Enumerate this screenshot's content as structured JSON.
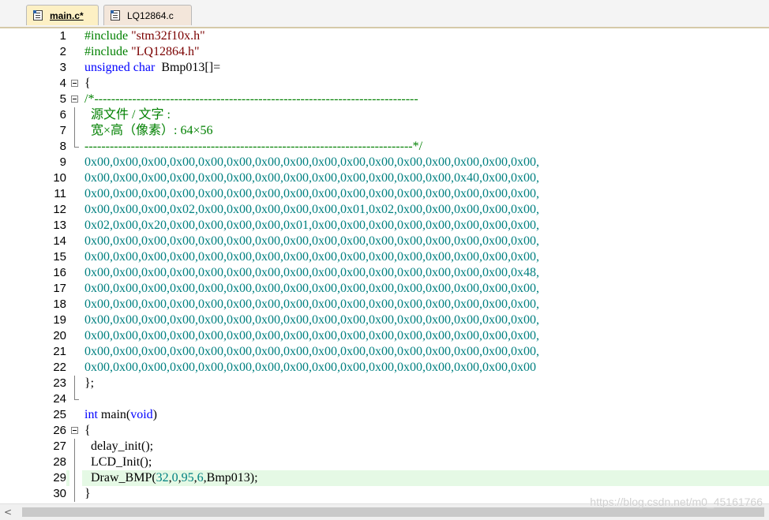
{
  "tabs": [
    {
      "label": "main.c*",
      "active": true
    },
    {
      "label": "LQ12864.c",
      "active": false
    }
  ],
  "colors": {
    "preprocessor": "#008000",
    "string": "#7a0000",
    "keyword": "#0000ff",
    "comment": "#008000",
    "hex_literal": "#008080",
    "current_line_bg": "#e5f9e5",
    "active_tab_bg": "#fdf0c4"
  },
  "lines": [
    {
      "n": "1",
      "tokens": [
        [
          "pp",
          "#include "
        ],
        [
          "str",
          "\"stm32f10x.h\""
        ]
      ]
    },
    {
      "n": "2",
      "tokens": [
        [
          "pp",
          "#include "
        ],
        [
          "str",
          "\"LQ12864.h\""
        ]
      ]
    },
    {
      "n": "3",
      "tokens": [
        [
          "kw",
          "unsigned"
        ],
        [
          "punc",
          " "
        ],
        [
          "kw",
          "char"
        ],
        [
          "punc",
          "  Bmp013[]="
        ]
      ]
    },
    {
      "n": "4",
      "fold": "box",
      "tokens": [
        [
          "punc",
          "{"
        ]
      ]
    },
    {
      "n": "5",
      "fold": "box",
      "tokens": [
        [
          "cmt",
          "/*-----------------------------------------------------------------------------"
        ]
      ]
    },
    {
      "n": "6",
      "fold": "line",
      "tokens": [
        [
          "cmt",
          "  源文件 / 文字 :"
        ]
      ]
    },
    {
      "n": "7",
      "fold": "line",
      "tokens": [
        [
          "cmt",
          "  宽×高（像素）: 64×56"
        ]
      ]
    },
    {
      "n": "8",
      "fold": "end",
      "tokens": [
        [
          "cmt",
          "------------------------------------------------------------------------------*/"
        ]
      ]
    },
    {
      "n": "9",
      "tokens": [
        [
          "hex",
          "0x00,0x00,0x00,0x00,0x00,0x00,0x00,0x00,0x00,0x00,0x00,0x00,0x00,0x00,0x00,0x00,"
        ]
      ]
    },
    {
      "n": "10",
      "tokens": [
        [
          "hex",
          "0x00,0x00,0x00,0x00,0x00,0x00,0x00,0x00,0x00,0x00,0x00,0x00,0x00,0x40,0x00,0x00,"
        ]
      ]
    },
    {
      "n": "11",
      "tokens": [
        [
          "hex",
          "0x00,0x00,0x00,0x00,0x00,0x00,0x00,0x00,0x00,0x00,0x00,0x00,0x00,0x00,0x00,0x00,"
        ]
      ]
    },
    {
      "n": "12",
      "tokens": [
        [
          "hex",
          "0x00,0x00,0x00,0x02,0x00,0x00,0x00,0x00,0x00,0x01,0x02,0x00,0x00,0x00,0x00,0x00,"
        ]
      ]
    },
    {
      "n": "13",
      "tokens": [
        [
          "hex",
          "0x02,0x00,0x20,0x00,0x00,0x00,0x00,0x01,0x00,0x00,0x00,0x00,0x00,0x00,0x00,0x00,"
        ]
      ]
    },
    {
      "n": "14",
      "tokens": [
        [
          "hex",
          "0x00,0x00,0x00,0x00,0x00,0x00,0x00,0x00,0x00,0x00,0x00,0x00,0x00,0x00,0x00,0x00,"
        ]
      ]
    },
    {
      "n": "15",
      "tokens": [
        [
          "hex",
          "0x00,0x00,0x00,0x00,0x00,0x00,0x00,0x00,0x00,0x00,0x00,0x00,0x00,0x00,0x00,0x00,"
        ]
      ]
    },
    {
      "n": "16",
      "tokens": [
        [
          "hex",
          "0x00,0x00,0x00,0x00,0x00,0x00,0x00,0x00,0x00,0x00,0x00,0x00,0x00,0x00,0x00,0x48,"
        ]
      ]
    },
    {
      "n": "17",
      "tokens": [
        [
          "hex",
          "0x00,0x00,0x00,0x00,0x00,0x00,0x00,0x00,0x00,0x00,0x00,0x00,0x00,0x00,0x00,0x00,"
        ]
      ]
    },
    {
      "n": "18",
      "tokens": [
        [
          "hex",
          "0x00,0x00,0x00,0x00,0x00,0x00,0x00,0x00,0x00,0x00,0x00,0x00,0x00,0x00,0x00,0x00,"
        ]
      ]
    },
    {
      "n": "19",
      "tokens": [
        [
          "hex",
          "0x00,0x00,0x00,0x00,0x00,0x00,0x00,0x00,0x00,0x00,0x00,0x00,0x00,0x00,0x00,0x00,"
        ]
      ]
    },
    {
      "n": "20",
      "tokens": [
        [
          "hex",
          "0x00,0x00,0x00,0x00,0x00,0x00,0x00,0x00,0x00,0x00,0x00,0x00,0x00,0x00,0x00,0x00,"
        ]
      ]
    },
    {
      "n": "21",
      "tokens": [
        [
          "hex",
          "0x00,0x00,0x00,0x00,0x00,0x00,0x00,0x00,0x00,0x00,0x00,0x00,0x00,0x00,0x00,0x00,"
        ]
      ]
    },
    {
      "n": "22",
      "tokens": [
        [
          "hex",
          "0x00,0x00,0x00,0x00,0x00,0x00,0x00,0x00,0x00,0x00,0x00,0x00,0x00,0x00,0x00,0x00"
        ]
      ]
    },
    {
      "n": "23",
      "fold": "line",
      "tokens": [
        [
          "punc",
          "};"
        ]
      ]
    },
    {
      "n": "24",
      "fold": "end",
      "tokens": []
    },
    {
      "n": "25",
      "tokens": [
        [
          "kw",
          "int"
        ],
        [
          "punc",
          " main("
        ],
        [
          "kw",
          "void"
        ],
        [
          "punc",
          ")"
        ]
      ]
    },
    {
      "n": "26",
      "fold": "box",
      "tokens": [
        [
          "punc",
          "{"
        ]
      ]
    },
    {
      "n": "27",
      "fold": "line",
      "tokens": [
        [
          "punc",
          "  delay_init();"
        ]
      ]
    },
    {
      "n": "28",
      "fold": "line",
      "tokens": [
        [
          "punc",
          "  LCD_Init();"
        ]
      ]
    },
    {
      "n": "29",
      "fold": "line",
      "current": true,
      "tokens": [
        [
          "punc",
          "  Draw_BMP("
        ],
        [
          "num",
          "32"
        ],
        [
          "punc",
          ","
        ],
        [
          "num",
          "0"
        ],
        [
          "punc",
          ","
        ],
        [
          "num",
          "95"
        ],
        [
          "punc",
          ","
        ],
        [
          "num",
          "6"
        ],
        [
          "punc",
          ",Bmp013);"
        ]
      ]
    },
    {
      "n": "30",
      "fold": "line",
      "tokens": [
        [
          "punc",
          "}"
        ]
      ]
    }
  ],
  "scrollbar": {
    "left_arrow": "<"
  },
  "watermark": "https://blog.csdn.net/m0_45161766"
}
